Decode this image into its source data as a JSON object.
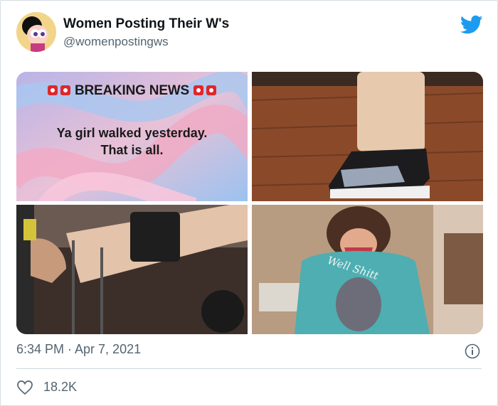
{
  "tweet": {
    "author_name": "Women Posting Their W's",
    "author_handle": "@womenpostingws",
    "timestamp": "6:34 PM · Apr 7, 2021",
    "like_count": "18.2K",
    "brand_color": "#1d9bf0"
  },
  "images": {
    "breaking_title": "BREAKING NEWS",
    "breaking_text_line1": "Ya girl walked yesterday.",
    "breaking_text_line2": "That is all.",
    "shirt_text": "Well Shitt"
  },
  "icons": {
    "twitter": "twitter-bird-icon",
    "info": "info-icon",
    "like": "heart-icon",
    "siren": "siren-emoji-icon"
  }
}
